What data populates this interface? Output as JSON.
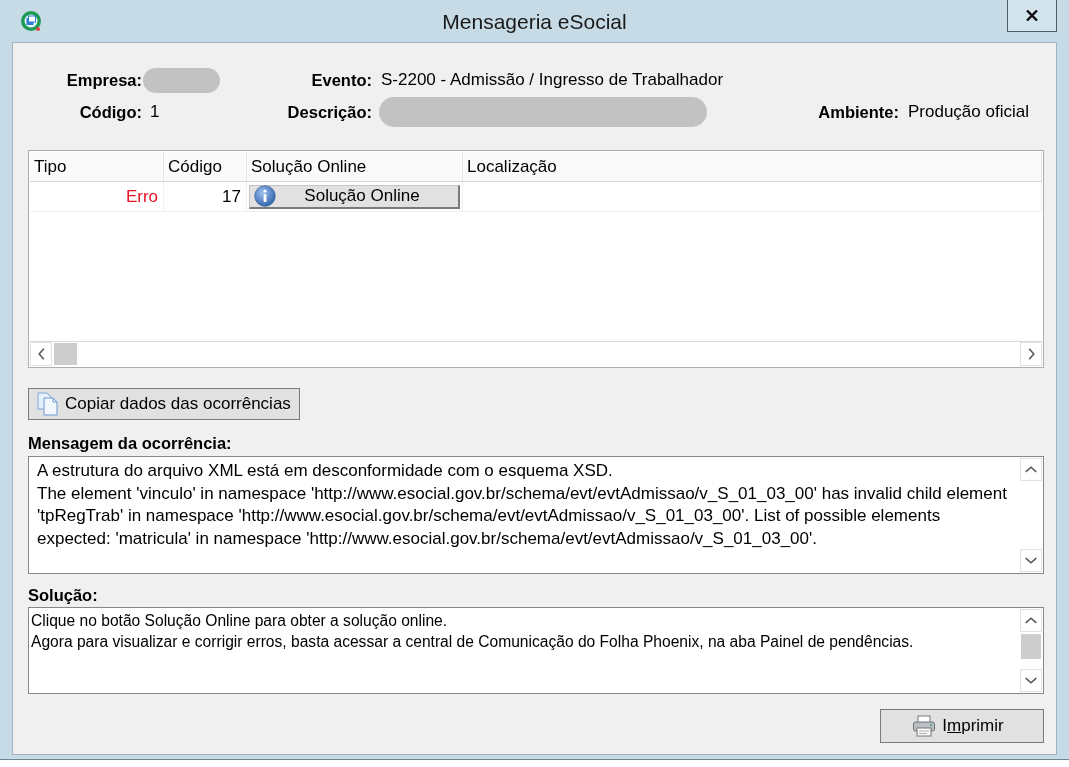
{
  "window": {
    "title": "Mensageria eSocial"
  },
  "header": {
    "rows": [
      [
        {
          "label": "Empresa:",
          "kind": "redacted"
        },
        {
          "label": "Evento:",
          "kind": "text",
          "value": "S-2200 - Admissão / Ingresso de Trabalhador"
        }
      ],
      [
        {
          "label": "Código:",
          "kind": "text",
          "value": "1"
        },
        {
          "label": "Descrição:",
          "kind": "redacted"
        },
        {
          "label": "Ambiente:",
          "kind": "text",
          "value": "Produção oficial"
        }
      ]
    ]
  },
  "table": {
    "columns": [
      "Tipo",
      "Código",
      "Solução Online",
      "Localização"
    ],
    "rows": [
      {
        "tipo": "Erro",
        "color": "#e81123",
        "codigo": "17",
        "action_button": "Solução Online"
      }
    ]
  },
  "copy_button": {
    "label": "Copiar dados das ocorrências"
  },
  "message": {
    "label": "Mensagem da ocorrência:",
    "lines": [
      "A estrutura do arquivo XML está em desconformidade com o esquema XSD.",
      "The element 'vinculo' in namespace 'http://www.esocial.gov.br/schema/evt/evtAdmissao/v_S_01_03_00' has invalid child element 'tpRegTrab' in namespace 'http://www.esocial.gov.br/schema/evt/evtAdmissao/v_S_01_03_00'. List of possible elements expected: 'matricula' in namespace 'http://www.esocial.gov.br/schema/evt/evtAdmissao/v_S_01_03_00'."
    ]
  },
  "solution": {
    "label": "Solução:",
    "lines": [
      "Clique no botão Solução Online para obter a solução online.",
      "Agora para visualizar e corrigir erros, basta acessar a central de Comunicação do Folha Phoenix, na aba Painel de pendências."
    ]
  },
  "print_button": {
    "label_before": "I",
    "mnemonic": "m",
    "label_after": "primir"
  }
}
